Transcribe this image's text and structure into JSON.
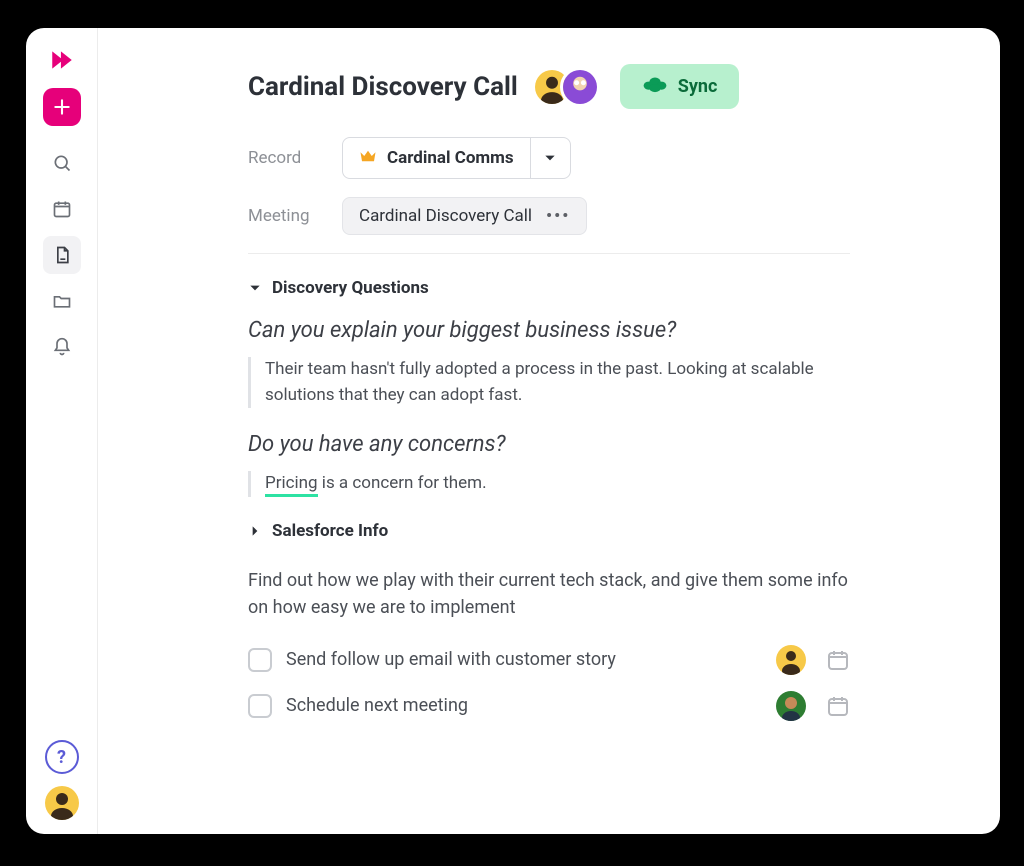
{
  "sidebar": {
    "logo": "scratchpad-logo",
    "add": "add",
    "icons": [
      "search",
      "calendar",
      "document",
      "folder",
      "bell"
    ],
    "active_index": 2,
    "help": "?"
  },
  "header": {
    "title": "Cardinal Discovery Call",
    "sync_label": "Sync"
  },
  "meta": {
    "record_label": "Record",
    "record_value": "Cardinal Comms",
    "meeting_label": "Meeting",
    "meeting_value": "Cardinal Discovery Call"
  },
  "sections": {
    "discovery": {
      "title": "Discovery Questions",
      "expanded": true,
      "q1": "Can you explain your biggest business issue?",
      "a1": "Their team hasn't fully adopted a process in the past. Looking at scalable solutions that they can adopt fast.",
      "q2": "Do you have any concerns?",
      "a2_highlight": "Pricing",
      "a2_rest": " is a concern for them."
    },
    "salesforce": {
      "title": "Salesforce Info",
      "expanded": false
    }
  },
  "note_body": "Find out how we play with their current tech stack, and give them some info on how easy we are to implement",
  "tasks": [
    {
      "label": "Send follow up email with customer story"
    },
    {
      "label": "Schedule next meeting"
    }
  ],
  "colors": {
    "brand": "#e6007a",
    "sync_bg": "#b7f0ce",
    "sync_fg": "#0b6b3a",
    "highlight": "#2de2a3"
  }
}
